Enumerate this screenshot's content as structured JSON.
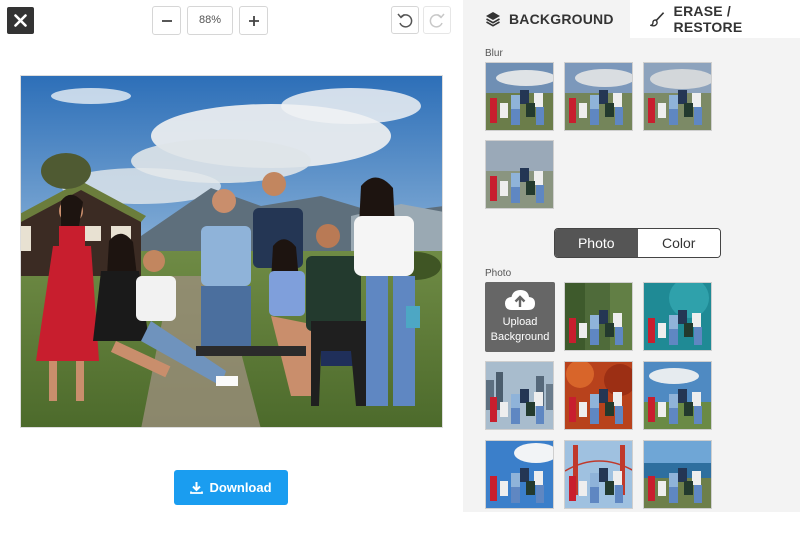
{
  "toolbar": {
    "close_icon": "close-icon",
    "zoom_value": "88%",
    "zoom_out_icon": "minus-icon",
    "zoom_in_icon": "plus-icon",
    "undo_icon": "undo-icon",
    "redo_icon": "redo-icon"
  },
  "download": {
    "label": "Download",
    "icon": "download-icon"
  },
  "tabs": [
    {
      "label": "BACKGROUND",
      "icon": "layers-icon",
      "active": true
    },
    {
      "label": "ERASE / RESTORE",
      "icon": "brush-icon",
      "active": false
    }
  ],
  "blur": {
    "label": "Blur"
  },
  "mode_toggle": {
    "options": [
      "Photo",
      "Color"
    ],
    "selected": "Photo"
  },
  "photo": {
    "label": "Photo",
    "upload_line1": "Upload",
    "upload_line2": "Background",
    "upload_icon": "cloud-upload-icon"
  },
  "colors": {
    "accent": "#1a9df0",
    "panel_bg": "#f3f3f3",
    "toggle_active": "#555555",
    "upload_bg": "#666666",
    "dark": "#333333"
  }
}
